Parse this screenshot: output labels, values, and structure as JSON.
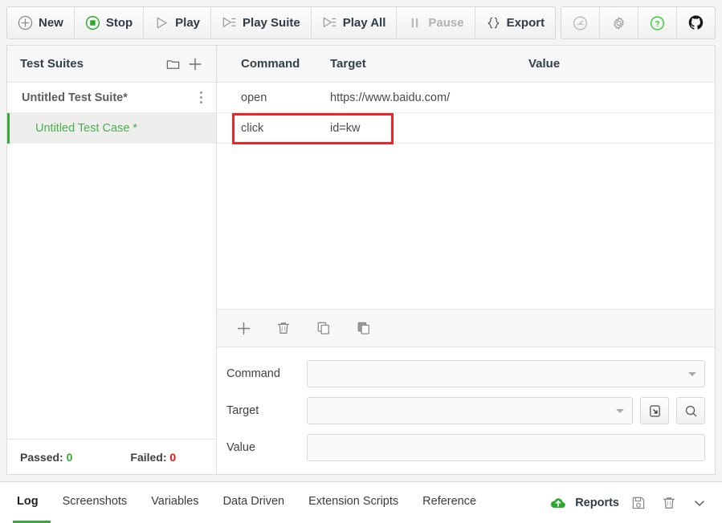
{
  "toolbar": {
    "buttons": [
      {
        "label": "New",
        "icon": "plus-circle-icon",
        "state": "enabled"
      },
      {
        "label": "Stop",
        "icon": "stop-icon",
        "state": "active"
      },
      {
        "label": "Play",
        "icon": "play-icon",
        "state": "enabled"
      },
      {
        "label": "Play Suite",
        "icon": "play-suite-icon",
        "state": "enabled"
      },
      {
        "label": "Play All",
        "icon": "play-all-icon",
        "state": "enabled"
      },
      {
        "label": "Pause",
        "icon": "pause-icon",
        "state": "disabled"
      },
      {
        "label": "Export",
        "icon": "braces-icon",
        "state": "enabled"
      }
    ],
    "right_icons": [
      {
        "name": "speedometer-icon"
      },
      {
        "name": "gear-icon"
      },
      {
        "name": "help-icon"
      },
      {
        "name": "github-icon"
      }
    ]
  },
  "sidebar": {
    "title": "Test Suites",
    "head_icons": [
      {
        "name": "new-folder-icon"
      },
      {
        "name": "plus-icon"
      }
    ],
    "suite": {
      "name": "Untitled Test Suite*",
      "menu_icon": "more-vertical-icon"
    },
    "cases": [
      {
        "name": "Untitled Test Case *",
        "selected": true
      }
    ],
    "footer": {
      "passed_label": "Passed:",
      "passed_value": "0",
      "failed_label": "Failed:",
      "failed_value": "0"
    }
  },
  "commands_table": {
    "columns": [
      "Command",
      "Target",
      "Value"
    ],
    "rows": [
      {
        "command": "open",
        "target": "https://www.baidu.com/",
        "value": "",
        "highlighted": false
      },
      {
        "command": "click",
        "target": "id=kw",
        "value": "",
        "highlighted": true
      }
    ]
  },
  "action_strip": [
    {
      "name": "add-command-icon"
    },
    {
      "name": "delete-command-icon"
    },
    {
      "name": "copy-command-icon"
    },
    {
      "name": "paste-command-icon"
    }
  ],
  "form": {
    "command": {
      "label": "Command",
      "value": "",
      "placeholder": ""
    },
    "target": {
      "label": "Target",
      "value": "",
      "placeholder": "",
      "buttons": [
        {
          "name": "select-target-icon"
        },
        {
          "name": "find-target-icon"
        }
      ]
    },
    "value": {
      "label": "Value",
      "value": "",
      "placeholder": ""
    }
  },
  "bottom": {
    "tabs": [
      {
        "label": "Log",
        "active": true
      },
      {
        "label": "Screenshots",
        "active": false
      },
      {
        "label": "Variables",
        "active": false
      },
      {
        "label": "Data Driven",
        "active": false
      },
      {
        "label": "Extension Scripts",
        "active": false
      },
      {
        "label": "Reference",
        "active": false
      }
    ],
    "reports_label": "Reports",
    "reports_icon": "cloud-upload-icon",
    "right_icons": [
      {
        "name": "save-log-icon"
      },
      {
        "name": "clear-log-icon"
      },
      {
        "name": "chevron-down-icon"
      }
    ]
  },
  "colors": {
    "accent_green": "#3ba639",
    "case_green": "#4caf50",
    "fail_red": "#e81414",
    "highlight_red": "#f42222",
    "text_dark": "#2e3c48",
    "disabled_gray": "#b3b3b3"
  }
}
